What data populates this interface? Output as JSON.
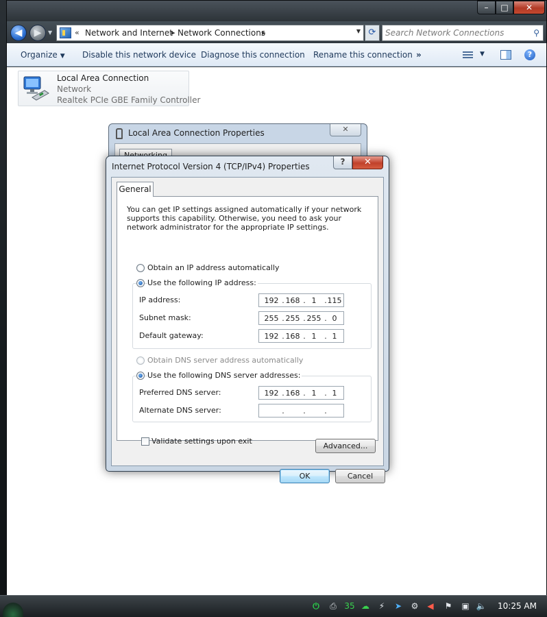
{
  "window": {
    "nav": {
      "breadcrumb_root": "«",
      "crumbs": [
        "Network and Internet",
        "Network Connections"
      ],
      "separator": "▸",
      "search_placeholder": "Search Network Connections",
      "refresh_glyph": "⟳"
    },
    "caption": {
      "minimize": "–",
      "maximize": "□",
      "close": "✕"
    },
    "commandbar": {
      "organize": "Organize",
      "disable": "Disable this network device",
      "diagnose": "Diagnose this connection",
      "rename": "Rename this connection",
      "more": "»",
      "help": "?"
    },
    "adapter": {
      "name": "Local Area Connection",
      "status": "Network",
      "device": "Realtek PCIe GBE Family Controller"
    }
  },
  "lan_dialog": {
    "title": "Local Area Connection Properties",
    "close": "✕",
    "tab": "Networking"
  },
  "ipv4_dialog": {
    "title": "Internet Protocol Version 4 (TCP/IPv4) Properties",
    "help": "?",
    "close": "✕",
    "tab": "General",
    "intro": "You can get IP settings assigned automatically if your network supports this capability. Otherwise, you need to ask your network administrator for the appropriate IP settings.",
    "ip_auto_label": "Obtain an IP address automatically",
    "ip_manual_label": "Use the following IP address:",
    "ip_address_label": "IP address:",
    "ip_address": [
      "192",
      "168",
      "1",
      "115"
    ],
    "subnet_label": "Subnet mask:",
    "subnet": [
      "255",
      "255",
      "255",
      "0"
    ],
    "gateway_label": "Default gateway:",
    "gateway": [
      "192",
      "168",
      "1",
      "1"
    ],
    "dns_auto_label": "Obtain DNS server address automatically",
    "dns_manual_label": "Use the following DNS server addresses:",
    "preferred_dns_label": "Preferred DNS server:",
    "preferred_dns": [
      "192",
      "168",
      "1",
      "1"
    ],
    "alternate_dns_label": "Alternate DNS server:",
    "alternate_dns": [
      "",
      "",
      "",
      ""
    ],
    "validate_label": "Validate settings upon exit",
    "advanced_button": "Advanced...",
    "ok_button": "OK",
    "cancel_button": "Cancel"
  },
  "taskbar": {
    "tray_counter": "35",
    "clock": "10:25 AM"
  },
  "colors": {
    "aero_dark": "#2d3338",
    "commandbar_text": "#1e395b",
    "close_red": "#c0412b",
    "ok_button_blue": "#3c7fb1"
  }
}
